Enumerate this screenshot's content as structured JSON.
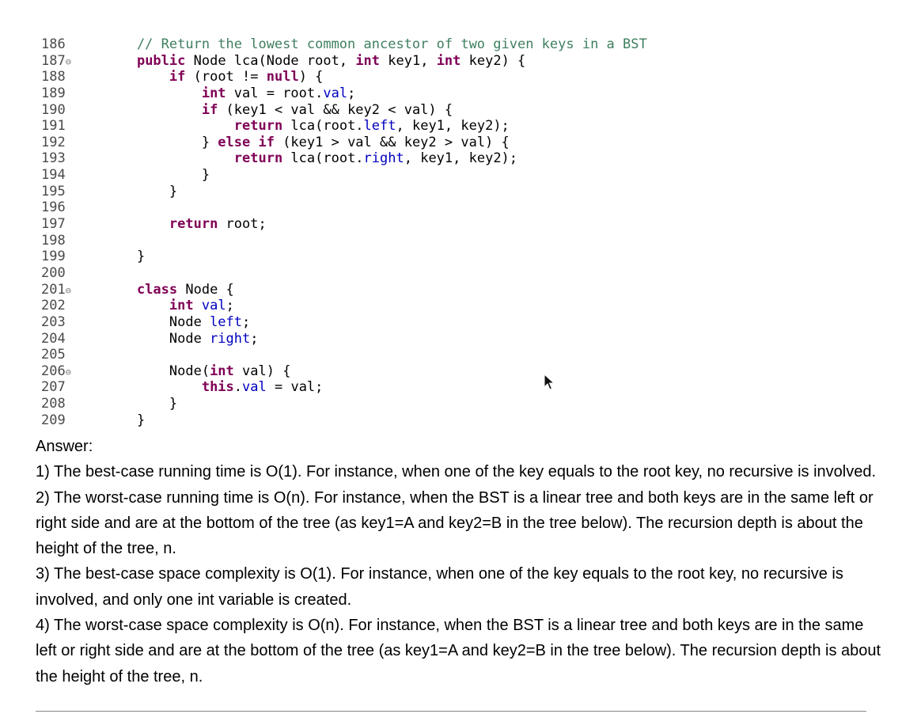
{
  "code": {
    "lines": [
      {
        "num": "186",
        "fold": "",
        "tokens": [
          {
            "t": "    // Return the lowest common ancestor of two given keys in a BST",
            "c": "cm"
          }
        ]
      },
      {
        "num": "187",
        "fold": "⊖",
        "tokens": [
          {
            "t": "    "
          },
          {
            "t": "public",
            "c": "kw"
          },
          {
            "t": " Node lca(Node root, "
          },
          {
            "t": "int",
            "c": "kw"
          },
          {
            "t": " key1, "
          },
          {
            "t": "int",
            "c": "kw"
          },
          {
            "t": " key2) {"
          }
        ]
      },
      {
        "num": "188",
        "fold": "",
        "tokens": [
          {
            "t": "        "
          },
          {
            "t": "if",
            "c": "kw"
          },
          {
            "t": " (root != "
          },
          {
            "t": "null",
            "c": "kw"
          },
          {
            "t": ") {"
          }
        ]
      },
      {
        "num": "189",
        "fold": "",
        "tokens": [
          {
            "t": "            "
          },
          {
            "t": "int",
            "c": "kw"
          },
          {
            "t": " val = root."
          },
          {
            "t": "val",
            "c": "fd"
          },
          {
            "t": ";"
          }
        ]
      },
      {
        "num": "190",
        "fold": "",
        "tokens": [
          {
            "t": "            "
          },
          {
            "t": "if",
            "c": "kw"
          },
          {
            "t": " (key1 < val && key2 < val) {"
          }
        ]
      },
      {
        "num": "191",
        "fold": "",
        "tokens": [
          {
            "t": "                "
          },
          {
            "t": "return",
            "c": "kw"
          },
          {
            "t": " lca(root."
          },
          {
            "t": "left",
            "c": "fd"
          },
          {
            "t": ", key1, key2);"
          }
        ]
      },
      {
        "num": "192",
        "fold": "",
        "tokens": [
          {
            "t": "            } "
          },
          {
            "t": "else if",
            "c": "kw"
          },
          {
            "t": " (key1 > val && key2 > val) {"
          }
        ]
      },
      {
        "num": "193",
        "fold": "",
        "tokens": [
          {
            "t": "                "
          },
          {
            "t": "return",
            "c": "kw"
          },
          {
            "t": " lca(root."
          },
          {
            "t": "right",
            "c": "fd"
          },
          {
            "t": ", key1, key2);"
          }
        ]
      },
      {
        "num": "194",
        "fold": "",
        "tokens": [
          {
            "t": "            }"
          }
        ]
      },
      {
        "num": "195",
        "fold": "",
        "tokens": [
          {
            "t": "        }"
          }
        ]
      },
      {
        "num": "196",
        "fold": "",
        "tokens": [
          {
            "t": ""
          }
        ]
      },
      {
        "num": "197",
        "fold": "",
        "tokens": [
          {
            "t": "        "
          },
          {
            "t": "return",
            "c": "kw"
          },
          {
            "t": " root;"
          }
        ]
      },
      {
        "num": "198",
        "fold": "",
        "tokens": [
          {
            "t": ""
          }
        ]
      },
      {
        "num": "199",
        "fold": "",
        "tokens": [
          {
            "t": "    }"
          }
        ]
      },
      {
        "num": "200",
        "fold": "",
        "tokens": [
          {
            "t": ""
          }
        ]
      },
      {
        "num": "201",
        "fold": "⊖",
        "tokens": [
          {
            "t": "    "
          },
          {
            "t": "class",
            "c": "kw"
          },
          {
            "t": " Node {"
          }
        ]
      },
      {
        "num": "202",
        "fold": "",
        "tokens": [
          {
            "t": "        "
          },
          {
            "t": "int",
            "c": "kw"
          },
          {
            "t": " "
          },
          {
            "t": "val",
            "c": "fd"
          },
          {
            "t": ";"
          }
        ]
      },
      {
        "num": "203",
        "fold": "",
        "tokens": [
          {
            "t": "        Node "
          },
          {
            "t": "left",
            "c": "fd"
          },
          {
            "t": ";"
          }
        ]
      },
      {
        "num": "204",
        "fold": "",
        "tokens": [
          {
            "t": "        Node "
          },
          {
            "t": "right",
            "c": "fd"
          },
          {
            "t": ";"
          }
        ]
      },
      {
        "num": "205",
        "fold": "",
        "tokens": [
          {
            "t": ""
          }
        ]
      },
      {
        "num": "206",
        "fold": "⊖",
        "tokens": [
          {
            "t": "        Node("
          },
          {
            "t": "int",
            "c": "kw"
          },
          {
            "t": " val) {"
          }
        ]
      },
      {
        "num": "207",
        "fold": "",
        "tokens": [
          {
            "t": "            "
          },
          {
            "t": "this",
            "c": "kw"
          },
          {
            "t": "."
          },
          {
            "t": "val",
            "c": "fd"
          },
          {
            "t": " = val;"
          }
        ]
      },
      {
        "num": "208",
        "fold": "",
        "tokens": [
          {
            "t": "        }"
          }
        ]
      },
      {
        "num": "209",
        "fold": "",
        "tokens": [
          {
            "t": "    }"
          }
        ]
      }
    ]
  },
  "answer": {
    "heading": "Answer:",
    "points": [
      "1) The best-case running time is O(1).  For instance, when one of the key equals to the root key, no recursive is involved.",
      "2) The worst-case running time is O(n).  For instance, when the BST is a linear tree and both keys are in the same left or right side and are at the bottom of the tree (as key1=A and key2=B in the tree below). The recursion depth is about the height of the tree, n.",
      "3) The best-case space complexity is O(1).  For instance, when one of the key equals to the root key, no recursive is involved, and only one int variable is created.",
      "4) The worst-case space complexity is O(n).  For instance, when the BST is a linear tree and both keys are in the same left or right side and are at the bottom of the tree (as key1=A and key2=B in the tree below). The recursion depth is about the height of the tree, n."
    ]
  },
  "icons": {
    "cursor": "mouse-pointer-icon",
    "fold": "fold-collapse-icon"
  },
  "colors": {
    "keyword": "#7f0055",
    "comment": "#3f7f5f",
    "field": "#0000c0",
    "line_number": "#4a4a4a"
  }
}
